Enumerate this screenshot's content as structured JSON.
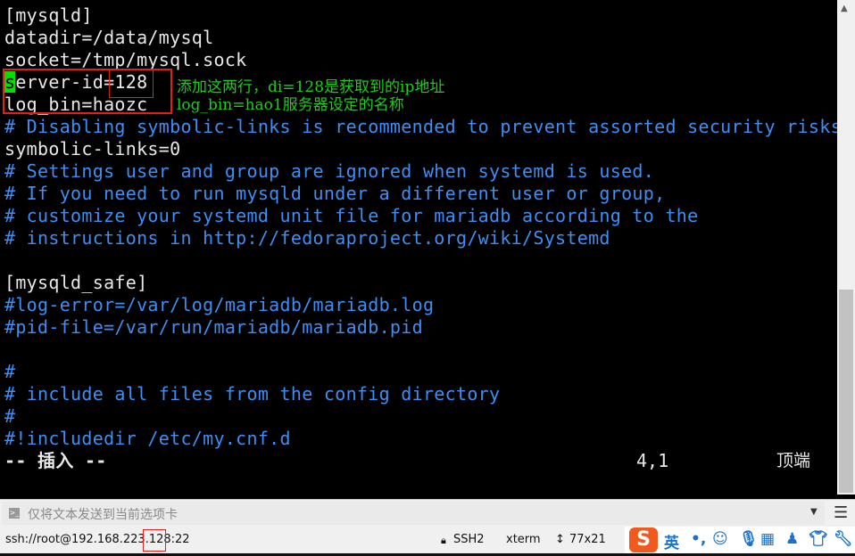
{
  "editor": {
    "lines": [
      {
        "text": "[mysqld]",
        "comment": false
      },
      {
        "text": "datadir=/data/mysql",
        "comment": false
      },
      {
        "text": "socket=/tmp/mysql.sock",
        "comment": false
      },
      {
        "text": "erver-id=128",
        "comment": false,
        "cursor_char": "s"
      },
      {
        "text": "log_bin=haozc",
        "comment": false
      },
      {
        "text": "# Disabling symbolic-links is recommended to prevent assorted security risks",
        "comment": true
      },
      {
        "text": "symbolic-links=0",
        "comment": false
      },
      {
        "text": "# Settings user and group are ignored when systemd is used.",
        "comment": true
      },
      {
        "text": "# If you need to run mysqld under a different user or group,",
        "comment": true
      },
      {
        "text": "# customize your systemd unit file for mariadb according to the",
        "comment": true
      },
      {
        "text": "# instructions in http://fedoraproject.org/wiki/Systemd",
        "comment": true
      },
      {
        "text": "",
        "comment": false
      },
      {
        "text": "[mysqld_safe]",
        "comment": false
      },
      {
        "text": "#log-error=/var/log/mariadb/mariadb.log",
        "comment": true
      },
      {
        "text": "#pid-file=/var/run/mariadb/mariadb.pid",
        "comment": true
      },
      {
        "text": "",
        "comment": false
      },
      {
        "text": "#",
        "comment": true
      },
      {
        "text": "# include all files from the config directory",
        "comment": true
      },
      {
        "text": "#",
        "comment": true
      },
      {
        "text": "#!includedir /etc/my.cnf.d",
        "comment": true
      }
    ],
    "mode": "-- 插入 --",
    "position": "4,1",
    "scroll_pos": "顶端",
    "annotation": [
      "添加这两行，di=128是获取到的ip地址",
      "log_bin=hao1服务器设定的名称"
    ]
  },
  "sendbar": {
    "placeholder": "仅将文本发送到当前选项卡"
  },
  "status": {
    "connection": "ssh://root@192.168.223.128:22",
    "protocol": "SSH2",
    "terminal": "xterm",
    "size": "77x21"
  },
  "ime": {
    "logo": "S",
    "lang": "英",
    "punct": "•,"
  }
}
